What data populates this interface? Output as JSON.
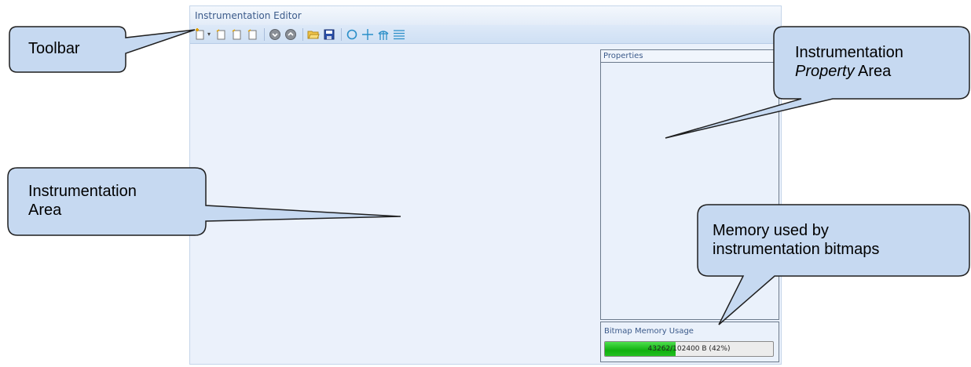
{
  "editor": {
    "title": "Instrumentation Editor",
    "toolbar": {
      "buttons": [
        {
          "icon": "new-page-icon",
          "has_dropdown": true
        },
        {
          "icon": "page-icon"
        },
        {
          "icon": "page-icon"
        },
        {
          "icon": "page-icon"
        },
        {
          "icon": "move-down-icon"
        },
        {
          "icon": "move-up-icon"
        },
        {
          "icon": "open-folder-icon"
        },
        {
          "icon": "save-icon"
        },
        {
          "icon": "circle-icon"
        },
        {
          "icon": "crosshair-icon"
        },
        {
          "icon": "antenna-icon"
        },
        {
          "icon": "lines-icon"
        }
      ]
    },
    "properties": {
      "header": "Properties"
    },
    "memory": {
      "label": "Bitmap Memory Usage",
      "used_text": "43262/102400 B (42%)",
      "fraction": 0.42
    }
  },
  "callouts": {
    "toolbar": "Toolbar",
    "property_area_line1": "Instrumentation",
    "property_area_italic": "Property",
    "property_area_rest": " Area",
    "instr_area_line1": "Instrumentation",
    "instr_area_line2": "Area",
    "memory_line1": "Memory used by",
    "memory_line2": "instrumentation bitmaps"
  },
  "colors": {
    "callout_fill": "#c6d9f1",
    "callout_stroke": "#1f1f1f",
    "progress_fill": "#18b818"
  }
}
